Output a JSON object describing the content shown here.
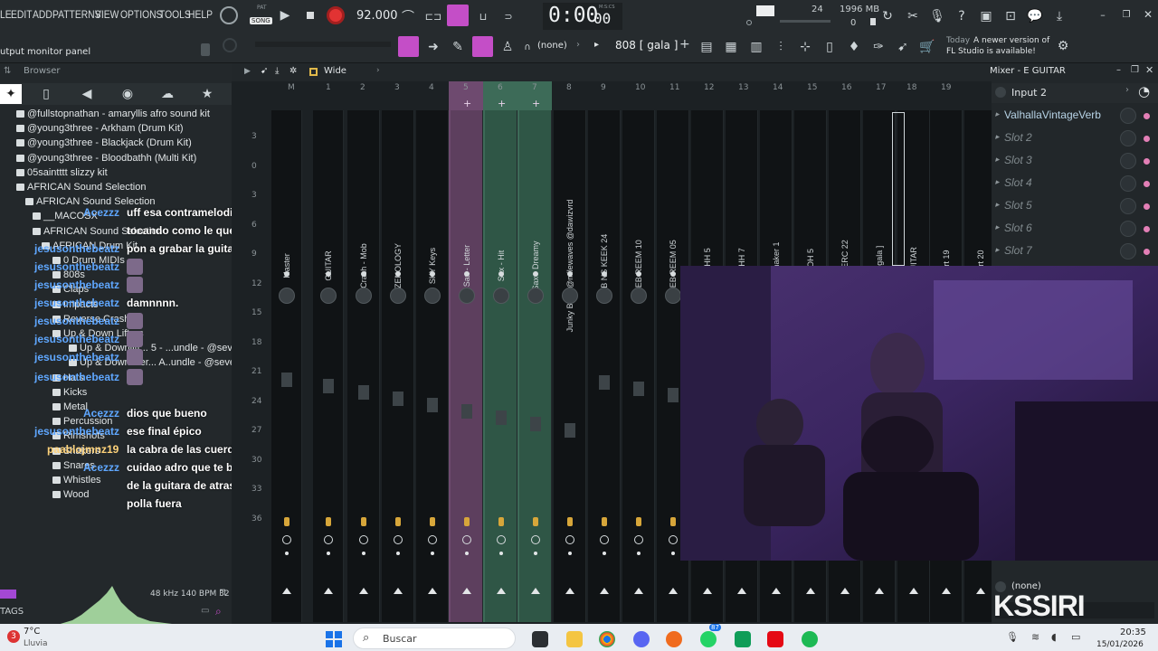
{
  "menu": {
    "items": [
      "LE",
      "EDIT",
      "ADD",
      "PATTERNS",
      "VIEW",
      "OPTIONS",
      "TOOLS",
      "HELP"
    ]
  },
  "transport": {
    "pat_label": "PAT",
    "song_label": "SONG",
    "tempo": "92.000",
    "time_main": "0:00",
    "time_sub": "00",
    "time_label": "M:S:CS"
  },
  "system": {
    "cpu_top": "24",
    "memory": "1996 MB",
    "mem_sub": "0"
  },
  "toolbar2": {
    "pattern_none": "(none)",
    "pattern_name": "808 [ gala ]",
    "news_date": "Today",
    "news_text_1": "A newer version of",
    "news_text_2": "FL Studio is available!"
  },
  "left_status": "utput monitor panel",
  "browser": {
    "title": "Browser",
    "tree": [
      "@fullstopnathan - amaryllis afro sound kit",
      "@young3three - Arkham (Drum Kit)",
      "@young3three - Blackjack (Drum Kit)",
      "@young3three - Bloodbathh (Multi Kit)",
      "05saintttt slizzy kit",
      "AFRICAN Sound Selection",
      "AFRICAN Sound Selection",
      "__MACOSX",
      "AFRICAN Sound Selection",
      "AFRICAN Drum Kit",
      "0 Drum MIDIs",
      "808s",
      "Claps",
      "Impacts",
      "Reverse Crash",
      "Up & Down Lifters",
      "Up & Downlift... 5 - ...undle - @seventhbeats",
      "Up & Downlifter... A..undle - @seventhbeats",
      "Hats",
      "Kicks",
      "Metal",
      "Percussion",
      "Rimshots",
      "Shakers",
      "Snares",
      "Whistles",
      "Wood"
    ],
    "sample_info": "48 kHz 140 BPM 32",
    "tags_label": "TAGS"
  },
  "chat": [
    {
      "name": "Acezzz",
      "msg": "uff esa contramelodia que esta"
    },
    {
      "name": "",
      "msg": "tocando como le queda"
    },
    {
      "name": "jesusonthebeatz",
      "msg": "pon a grabar la guitar ad"
    },
    {
      "name": "jesusonthebeatz",
      "msg": ""
    },
    {
      "name": "jesusonthebeatz",
      "msg": ""
    },
    {
      "name": "jesusonthebeatz",
      "msg": "damnnnn."
    },
    {
      "name": "jesusonthebeatz",
      "msg": ""
    },
    {
      "name": "jesusonthebeatz",
      "msg": ""
    },
    {
      "name": "jesusonthebeatz",
      "msg": ""
    },
    {
      "name": "jesusonthebeatz",
      "msg": ""
    },
    {
      "name": "Acezzz",
      "msg": "dios que bueno"
    },
    {
      "name": "jesusonthebeatz",
      "msg": "ese final épico"
    },
    {
      "name": "paablojmnz19",
      "msg": "la cabra de las cuerdas"
    },
    {
      "name": "Acezzz",
      "msg": "cuidao adro que te banean que el"
    },
    {
      "name": "",
      "msg": "de la guitara de atras va con la"
    },
    {
      "name": "",
      "msg": "polla fuera"
    }
  ],
  "mixer": {
    "header": "Wide",
    "col_numbers": [
      "M",
      "1",
      "2",
      "3",
      "4",
      "5",
      "6",
      "7",
      "8",
      "9",
      "10",
      "11",
      "12",
      "13",
      "14",
      "15",
      "16",
      "17",
      "18",
      "19"
    ],
    "db_scale": [
      "3",
      "0",
      "3",
      "6",
      "9",
      "12",
      "15",
      "18",
      "21",
      "24",
      "27",
      "30",
      "33",
      "36"
    ],
    "tracks": [
      "Master",
      "GUITAR",
      "Crash - Mob",
      "ZENOLOGY",
      "SKY Keys",
      "Sax - Letter",
      "Sax - Hit",
      "Sax - Dreamy",
      "Junky Bass @milewaves @dawizvrd",
      "JEB NS KEEK 24",
      "JEB REEM 10",
      "JEB REEM 05",
      "JEB HH 5",
      "JEB HH 7",
      "Jeb Shaker 1",
      "Jeb OH 5",
      "BS - PERC 22",
      "808 [ gala ]",
      "E GUITAR",
      "Insert 19",
      "Insert 20"
    ]
  },
  "insert_panel": {
    "title": "Mixer - E GUITAR",
    "input": "Input 2",
    "slots": [
      "ValhallaVintageVerb",
      "Slot 2",
      "Slot 3",
      "Slot 4",
      "Slot 5",
      "Slot 6",
      "Slot 7"
    ],
    "out_label": "(none)"
  },
  "watermark": "KSSIRI",
  "taskbar": {
    "weather_temp": "7°C",
    "weather_desc": "Lluvia",
    "search": "Buscar",
    "time": "20:35",
    "date": "15/01/2026",
    "badge_chat": "87",
    "weather_badge": "3"
  },
  "colors": {
    "accent": "#c44ec7",
    "tempo_red": "#e23333",
    "selected_green": "#3d6b58",
    "selected_pink": "#6e4a6f"
  }
}
